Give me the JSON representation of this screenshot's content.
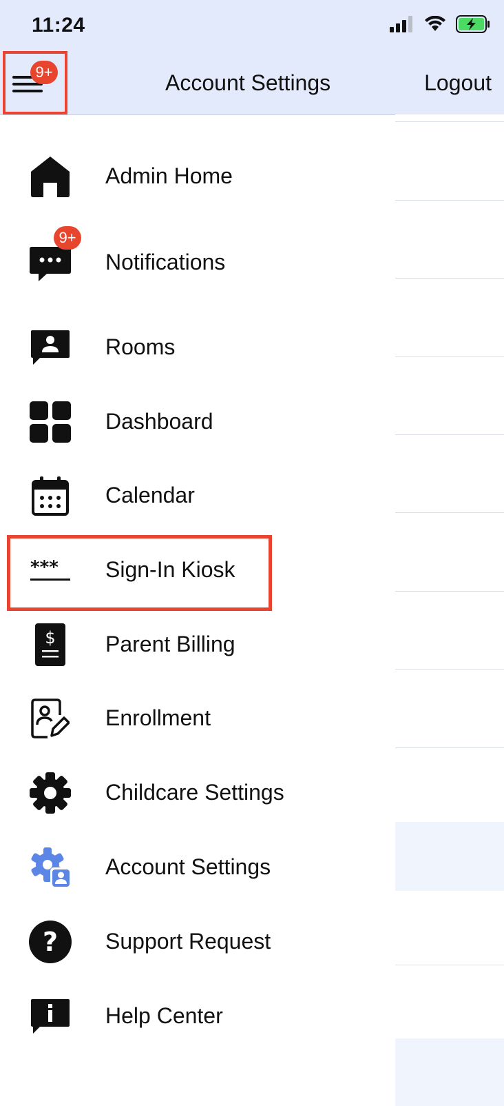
{
  "status_bar": {
    "time": "11:24"
  },
  "header": {
    "menu_badge": "9+",
    "title": "Account Settings",
    "logout_label": "Logout"
  },
  "drawer": {
    "items": [
      {
        "label": "Admin Home"
      },
      {
        "label": "Notifications",
        "badge": "9+"
      },
      {
        "label": "Rooms"
      },
      {
        "label": "Dashboard"
      },
      {
        "label": "Calendar"
      },
      {
        "label": "Sign-In Kiosk"
      },
      {
        "label": "Parent Billing"
      },
      {
        "label": "Enrollment"
      },
      {
        "label": "Childcare Settings"
      },
      {
        "label": "Account Settings"
      },
      {
        "label": "Support Request"
      },
      {
        "label": "Help Center"
      }
    ]
  },
  "colors": {
    "header_bg": "#e2eafc",
    "highlight": "#e8442f",
    "badge": "#e8452f",
    "account_icon": "#5b86e5"
  }
}
